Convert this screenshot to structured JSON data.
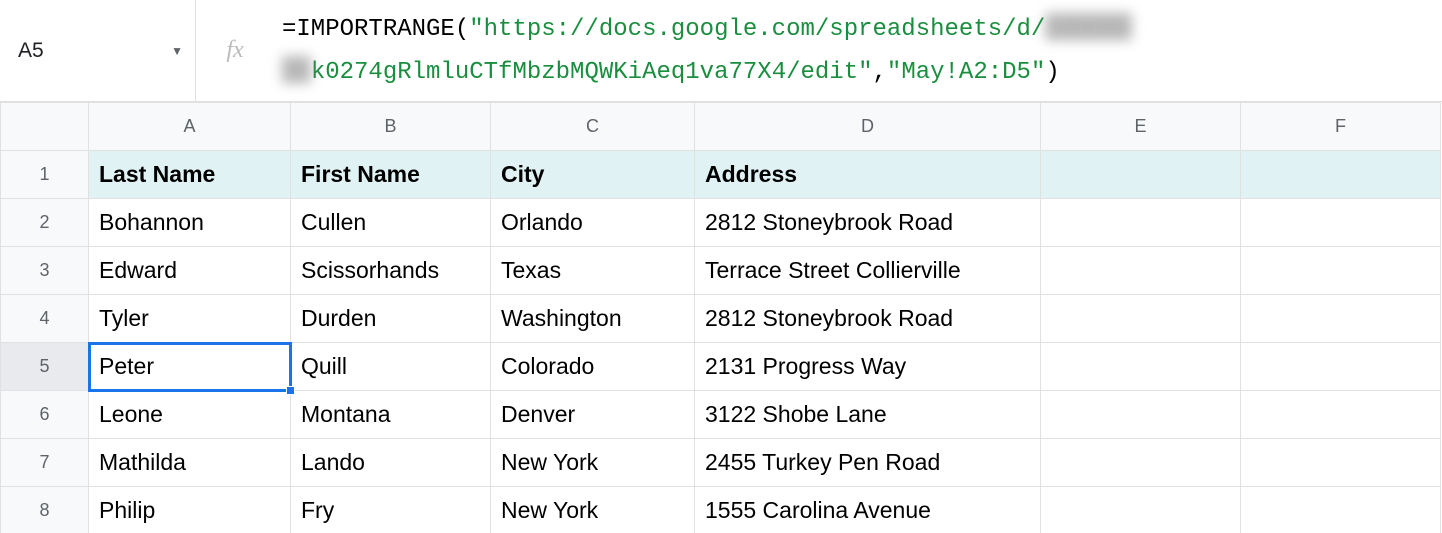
{
  "formulaBar": {
    "cellRef": "A5",
    "fx": "fx",
    "formula_prefix": "=IMPORTRANGE(",
    "formula_string1_part1": "\"https://docs.google.com/spreadsheets/d/",
    "formula_blur1": "██████",
    "formula_blur2": "██",
    "formula_string1_part2": "k0274gRlmluCTfMbzbMQWKiAeq1va77X4/edit\"",
    "formula_sep": ",",
    "formula_string2": "\"May!A2:D5\"",
    "formula_suffix": ")"
  },
  "columns": [
    "A",
    "B",
    "C",
    "D",
    "E",
    "F"
  ],
  "rowNumbers": [
    "1",
    "2",
    "3",
    "4",
    "5",
    "6",
    "7",
    "8"
  ],
  "selectedRow": "5",
  "headerRow": {
    "a": "Last Name",
    "b": "First Name",
    "c": "City",
    "d": "Address"
  },
  "rows": [
    {
      "a": "Bohannon",
      "b": "Cullen",
      "c": "Orlando",
      "d": "2812 Stoneybrook Road"
    },
    {
      "a": "Edward",
      "b": "Scissorhands",
      "c": "Texas",
      "d": "Terrace Street Collierville"
    },
    {
      "a": "Tyler",
      "b": "Durden",
      "c": "Washington",
      "d": "2812 Stoneybrook Road"
    },
    {
      "a": "Peter",
      "b": "Quill",
      "c": "Colorado",
      "d": "2131 Progress Way"
    },
    {
      "a": "Leone",
      "b": "Montana",
      "c": "Denver",
      "d": "3122 Shobe Lane"
    },
    {
      "a": "Mathilda",
      "b": "Lando",
      "c": "New York",
      "d": "2455 Turkey Pen Road"
    },
    {
      "a": "Philip",
      "b": "Fry",
      "c": "New York",
      "d": "1555 Carolina Avenue"
    }
  ]
}
